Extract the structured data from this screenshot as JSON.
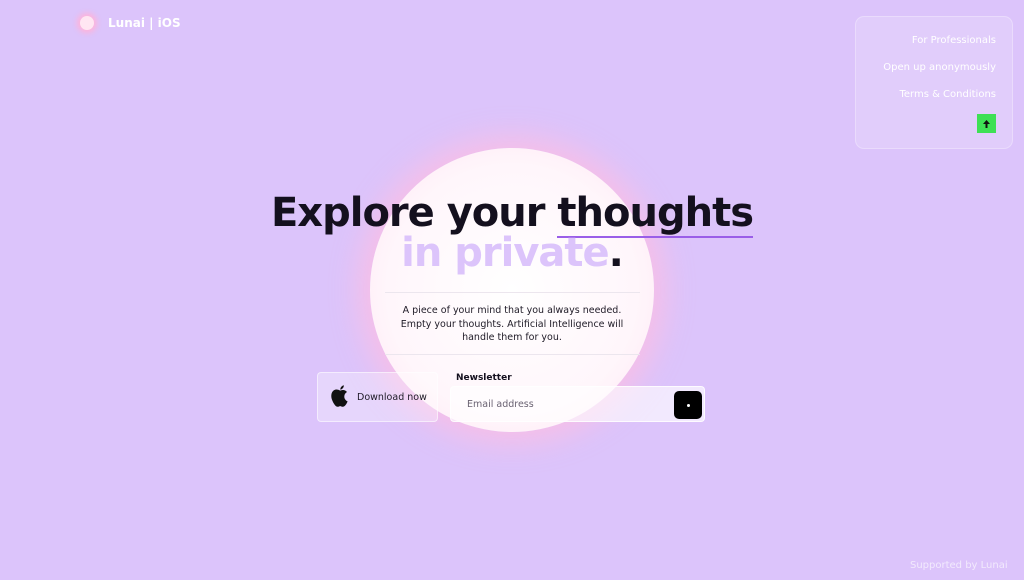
{
  "logo": {
    "text": "Lunai | iOS"
  },
  "menu": {
    "items": [
      "For Professionals",
      "Open up anonymously",
      "Terms & Conditions"
    ],
    "button_icon": "up-arrow-icon",
    "button_color": "#3ee055"
  },
  "hero": {
    "line1_a": "Explore your",
    "line1_b": "thoughts",
    "line2": "in private",
    "line2_dot": "."
  },
  "description": "A piece of your mind that you always needed. Empty your thoughts. Artificial Intelligence will handle them for you.",
  "download": {
    "label": "Download now",
    "icon": "apple-icon"
  },
  "newsletter": {
    "label": "Newsletter",
    "placeholder": "Email address",
    "submit_icon": "dot-icon"
  },
  "support": "Supported by Lunai",
  "colors": {
    "background": "#dcc4fb",
    "accent": "#9a5ee8",
    "text": "#14101e"
  }
}
